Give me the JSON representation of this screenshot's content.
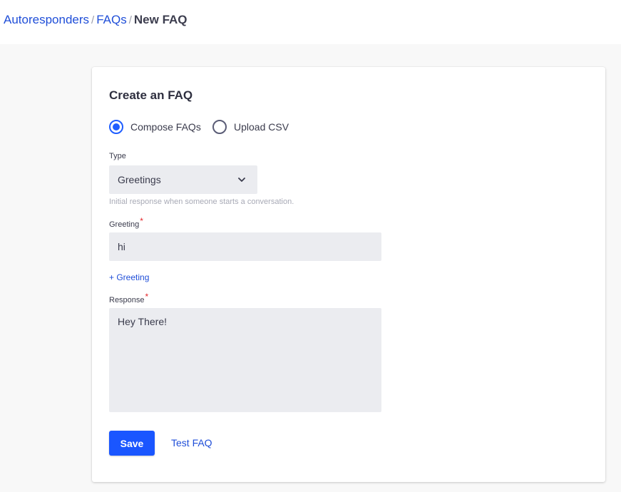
{
  "breadcrumb": {
    "items": [
      "Autoresponders",
      "FAQs"
    ],
    "current": "New FAQ",
    "separator": "/"
  },
  "form": {
    "title": "Create an FAQ",
    "modes": [
      {
        "label": "Compose FAQs",
        "selected": true
      },
      {
        "label": "Upload CSV",
        "selected": false
      }
    ],
    "type": {
      "label": "Type",
      "value": "Greetings",
      "helper": "Initial response when someone starts a conversation."
    },
    "greeting": {
      "label": "Greeting",
      "required_mark": "*",
      "value": "hi"
    },
    "add_greeting_label": "+ Greeting",
    "response": {
      "label": "Response",
      "required_mark": "*",
      "value": "Hey There!"
    },
    "save_label": "Save",
    "test_label": "Test FAQ"
  },
  "icons": {
    "select_chevron": "chevron-down-icon"
  },
  "colors": {
    "accent": "#1a56ff",
    "link": "#1f4ed8",
    "required": "#e5252a",
    "field_bg": "#ebecf0"
  }
}
